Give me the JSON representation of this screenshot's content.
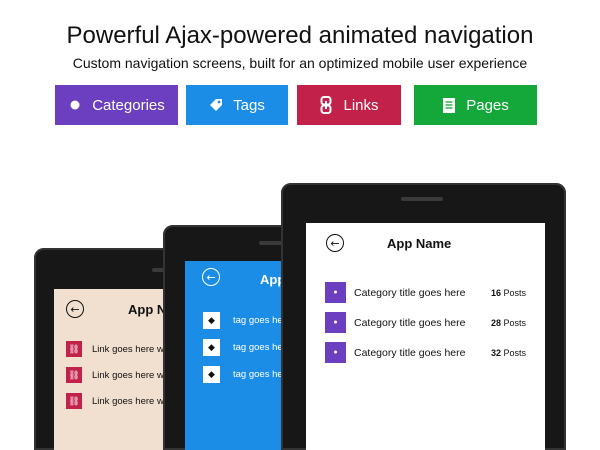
{
  "header": {
    "title": "Powerful Ajax-powered animated navigation",
    "subtitle": "Custom navigation screens, built for an optimized mobile user experience"
  },
  "tabs": [
    {
      "label": "Categories",
      "icon": "circle-icon",
      "color": "#6c3fc0"
    },
    {
      "label": "Tags",
      "icon": "tag-icon",
      "color": "#1c8de6"
    },
    {
      "label": "Links",
      "icon": "link-icon",
      "color": "#c2214a"
    },
    {
      "label": "Pages",
      "icon": "page-icon",
      "color": "#14a83b"
    }
  ],
  "phones": {
    "links": {
      "app_name": "App N",
      "bg_color": "#f1e0cf",
      "items": [
        {
          "label": "Link goes here w"
        },
        {
          "label": "Link goes here w"
        },
        {
          "label": "Link goes here w"
        }
      ]
    },
    "tags": {
      "app_name": "App",
      "bg_color": "#1c8de6",
      "items": [
        {
          "label": "tag goes he"
        },
        {
          "label": "tag goes he"
        },
        {
          "label": "tag goes he"
        }
      ]
    },
    "categories": {
      "app_name": "App Name",
      "bg_color": "#ffffff",
      "items": [
        {
          "label": "Category title goes here",
          "count": "16",
          "count_suffix": "Posts"
        },
        {
          "label": "Category title goes here",
          "count": "28",
          "count_suffix": "Posts"
        },
        {
          "label": "Category title goes here",
          "count": "32",
          "count_suffix": "Posts"
        }
      ]
    }
  }
}
